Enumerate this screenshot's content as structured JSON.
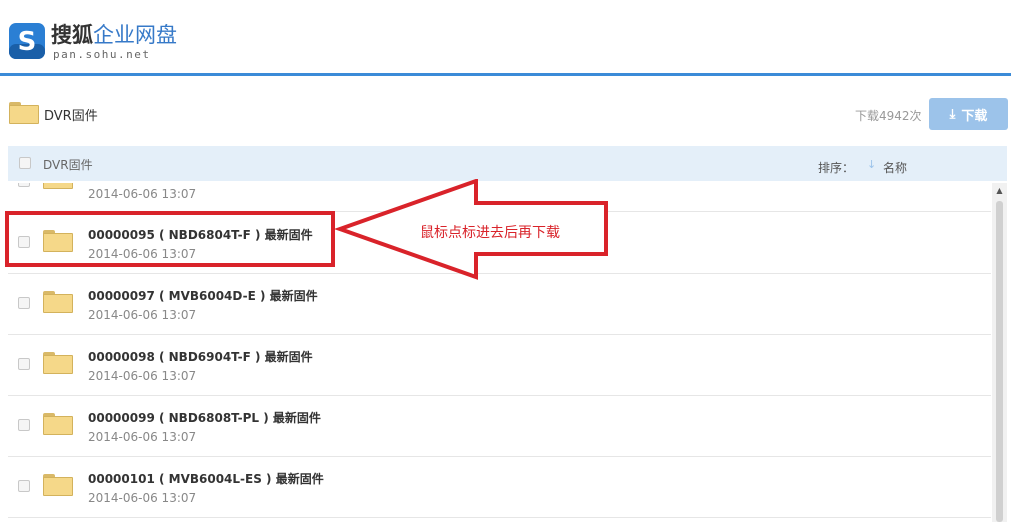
{
  "header": {
    "brand_part1": "搜狐",
    "brand_part2": "企业网盘",
    "domain": "pan.sohu.net",
    "logo_letter": "S"
  },
  "breadcrumb": {
    "title": "DVR固件"
  },
  "download": {
    "count_label": "下载4942次",
    "button_label": "下载",
    "icon": "download-icon"
  },
  "list_header": {
    "title": "DVR固件",
    "sort_label": "排序：",
    "sort_field": "名称"
  },
  "partial_item": {
    "date": "2014-06-06 13:07"
  },
  "items": [
    {
      "name": "00000095 ( NBD6804T-F ) 最新固件",
      "date": "2014-06-06 13:07"
    },
    {
      "name": "00000097 ( MVB6004D-E ) 最新固件",
      "date": "2014-06-06 13:07"
    },
    {
      "name": "00000098 ( NBD6904T-F ) 最新固件",
      "date": "2014-06-06 13:07"
    },
    {
      "name": "00000099 ( NBD6808T-PL ) 最新固件",
      "date": "2014-06-06 13:07"
    },
    {
      "name": "00000101 ( MVB6004L-ES ) 最新固件",
      "date": "2014-06-06 13:07"
    }
  ],
  "annotation": {
    "text": "鼠标点标进去后再下载",
    "color": "#d9232a"
  },
  "colors": {
    "accent": "#3b8bd8",
    "button": "#9cc3ea",
    "header_bg": "#e4eff9"
  }
}
